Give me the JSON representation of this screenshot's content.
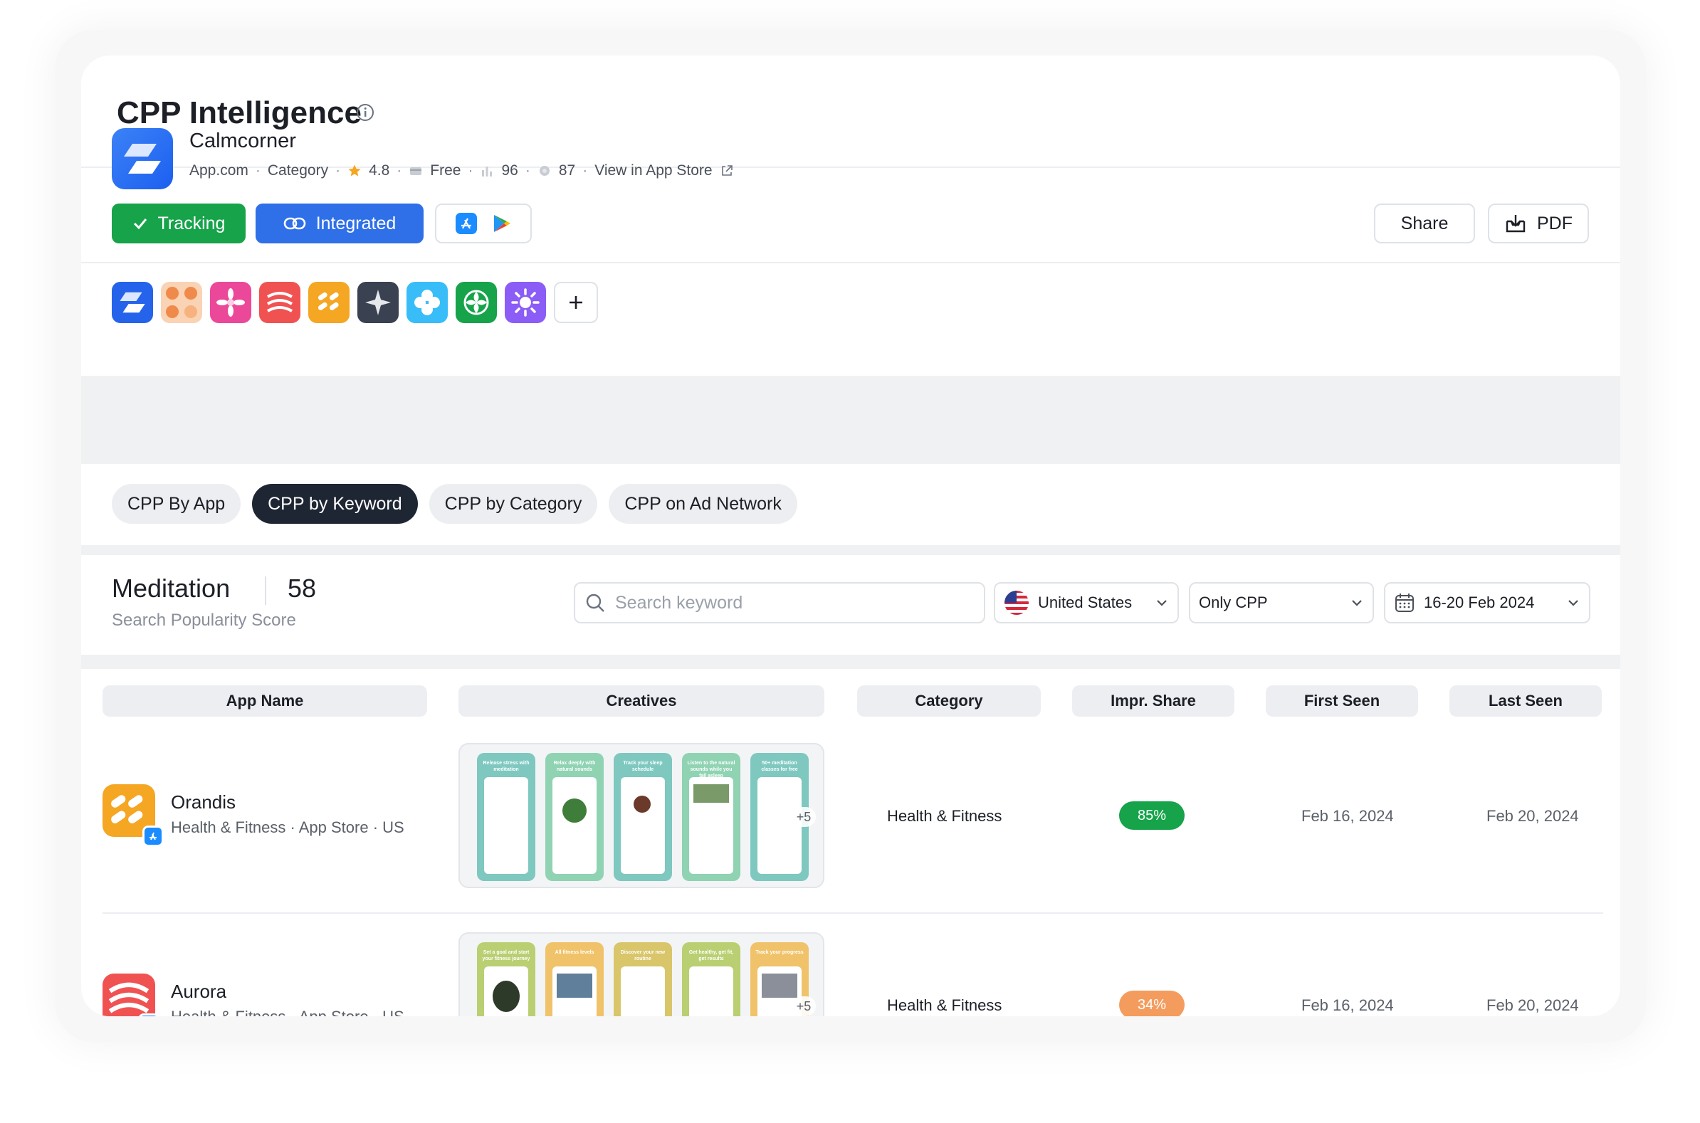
{
  "header": {
    "title": "CPP Intelligence"
  },
  "app": {
    "name": "Calmcorner",
    "developer": "App.com",
    "category": "Category",
    "rating": "4.8",
    "price": "Free",
    "rank": "96",
    "score": "87",
    "store_link": "View in App Store",
    "tracking_label": "Tracking",
    "integrated_label": "Integrated",
    "share_label": "Share",
    "pdf_label": "PDF"
  },
  "competitors": [
    {
      "color": "#2563eb"
    },
    {
      "color": "#f7b98b"
    },
    {
      "color": "#ec4899"
    },
    {
      "color": "#f05252"
    },
    {
      "color": "#f5a623"
    },
    {
      "color": "#3a4150"
    },
    {
      "color": "#38bdf8"
    },
    {
      "color": "#16a34a"
    },
    {
      "color": "#8b5cf6"
    }
  ],
  "tabs": [
    {
      "label": "CPP By App",
      "active": false
    },
    {
      "label": "CPP by Keyword",
      "active": true
    },
    {
      "label": "CPP by Category",
      "active": false
    },
    {
      "label": "CPP on Ad Network",
      "active": false
    }
  ],
  "keyword": {
    "term": "Meditation",
    "score": "58",
    "score_label": "Search Popularity Score",
    "search_placeholder": "Search keyword",
    "country": "United States",
    "filter": "Only CPP",
    "date_range": "16-20 Feb 2024"
  },
  "table": {
    "columns": [
      "App Name",
      "Creatives",
      "Category",
      "Impr. Share",
      "First Seen",
      "Last Seen"
    ],
    "rows": [
      {
        "name": "Orandis",
        "sub": "Health & Fitness · App Store · US",
        "category": "Health & Fitness",
        "impr_share": "85%",
        "impr_color": "#16a34a",
        "first_seen": "Feb 16, 2024",
        "last_seen": "Feb 20, 2024",
        "more": "+5",
        "captions": [
          "Release stress with meditation",
          "Relax deeply with natural sounds",
          "Track your sleep schedule",
          "Listen to the natural sounds while you fall asleep",
          "50+ meditation classes for free"
        ]
      },
      {
        "name": "Aurora",
        "sub": "Health & Fitness · App Store · US",
        "category": "Health & Fitness",
        "impr_share": "34%",
        "impr_color": "#f49c5e",
        "first_seen": "Feb 16, 2024",
        "last_seen": "Feb 20, 2024",
        "more": "+5",
        "captions": [
          "Set a goal and start your fitness journey",
          "All fitness levels",
          "Discover your new routine",
          "Get healthy, get fit, get results",
          "Track your progress"
        ]
      }
    ]
  }
}
